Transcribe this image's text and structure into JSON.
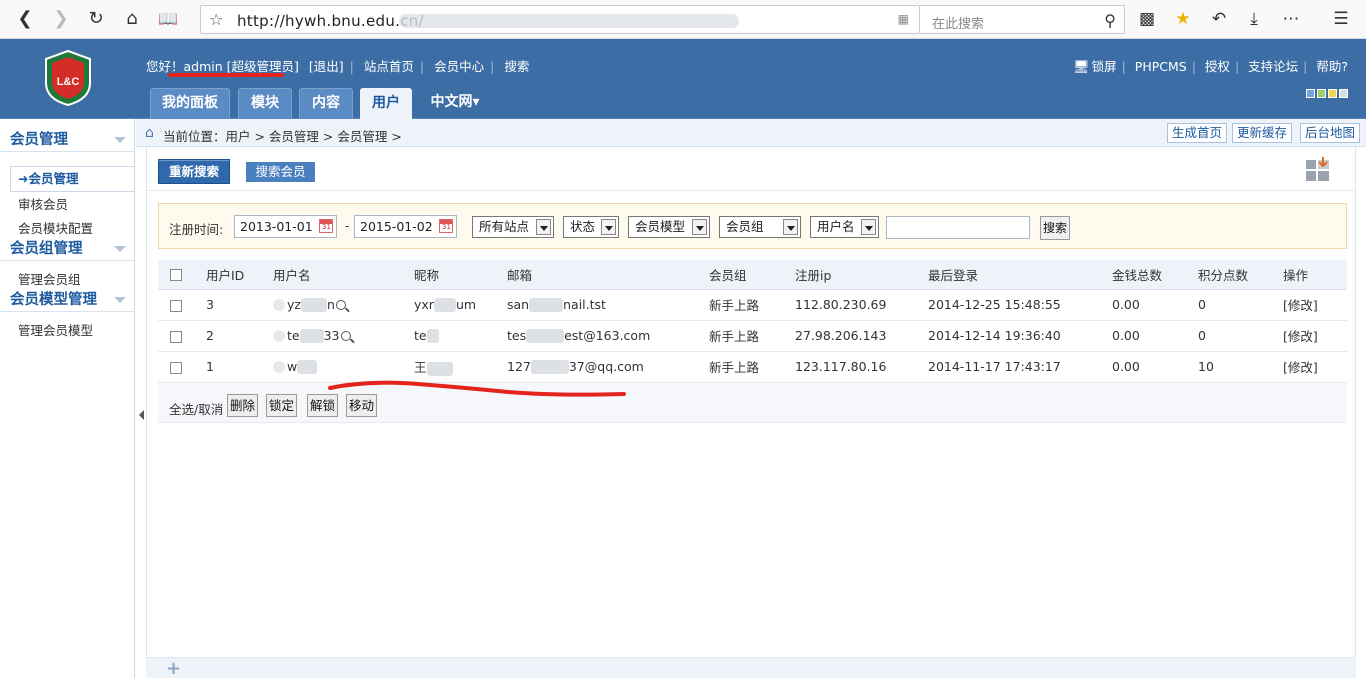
{
  "browser": {
    "url": "http://hywh.bnu.edu.cn/",
    "search_placeholder": "在此搜索",
    "icons": [
      "back-icon",
      "forward-icon",
      "reload-icon",
      "home-icon",
      "reader-icon",
      "star-outline-icon",
      "qr-icon",
      "search-icon",
      "pocket-icon",
      "bookmark-star-icon",
      "undo-icon",
      "download-icon",
      "more-icon",
      "menu-icon"
    ]
  },
  "header": {
    "greeting": "您好！",
    "user": "admin [超级管理员]",
    "logout": "[退出]",
    "links": [
      "站点首页",
      "会员中心",
      "搜索"
    ],
    "right_links": [
      "锁屏",
      "PHPCMS",
      "授权",
      "支持论坛",
      "帮助?"
    ],
    "logo_text": "L&C",
    "tabs": [
      {
        "label": "我的面板",
        "active": false
      },
      {
        "label": "模块",
        "active": false
      },
      {
        "label": "内容",
        "active": false
      },
      {
        "label": "用户",
        "active": true
      },
      {
        "label": "中文网▾",
        "active": false
      }
    ],
    "swatch_colors": [
      "#6fa6dc",
      "#9ed06a",
      "#f0d54a",
      "#d8dde4"
    ]
  },
  "sidebar": {
    "groups": [
      {
        "title": "会员管理",
        "items": [
          {
            "label": "会员管理",
            "active": true
          },
          {
            "label": "审核会员",
            "active": false
          },
          {
            "label": "会员模块配置",
            "active": false
          }
        ]
      },
      {
        "title": "会员组管理",
        "items": [
          {
            "label": "管理会员组",
            "active": false
          }
        ]
      },
      {
        "title": "会员模型管理",
        "items": [
          {
            "label": "管理会员模型",
            "active": false
          }
        ]
      }
    ]
  },
  "breadcrumb": {
    "text": "当前位置：用户 > 会员管理 > 会员管理 >",
    "buttons": [
      "生成首页",
      "更新缓存",
      "后台地图"
    ]
  },
  "toolbar": {
    "primary": "重新搜索",
    "secondary": "搜索会员"
  },
  "filter": {
    "label": "注册时间:",
    "date_from": "2013-01-01",
    "date_to": "2015-01-02",
    "dash": "-",
    "selects": [
      "所有站点",
      "状态",
      "会员模型",
      "会员组",
      "用户名"
    ],
    "keyword": "",
    "search_button": "搜索"
  },
  "table": {
    "headers": [
      "",
      "用户ID",
      "用户名",
      "昵称",
      "邮箱",
      "会员组",
      "注册ip",
      "最后登录",
      "金钱总数",
      "积分点数",
      "操作"
    ],
    "rows": [
      {
        "id": "3",
        "username_pre": "yz",
        "username_post": "n",
        "nickname_pre": "yxr",
        "nickname_post": "um",
        "email_pre": "san",
        "email_post": "nail.tst",
        "group": "新手上路",
        "ip": "112.80.230.69",
        "last_login": "2014-12-25 15:48:55",
        "money": "0.00",
        "points": "0",
        "action": "[修改]"
      },
      {
        "id": "2",
        "username_pre": "te",
        "username_post": "33",
        "nickname_pre": "te",
        "nickname_post": "",
        "email_pre": "tes",
        "email_post": "est@163.com",
        "group": "新手上路",
        "ip": "27.98.206.143",
        "last_login": "2014-12-14 19:36:40",
        "money": "0.00",
        "points": "0",
        "action": "[修改]"
      },
      {
        "id": "1",
        "username_pre": "w",
        "username_post": "",
        "nickname_pre": "王",
        "nickname_post": "",
        "email_pre": "127",
        "email_post": "37@qq.com",
        "group": "新手上路",
        "ip": "123.117.80.16",
        "last_login": "2014-11-17 17:43:17",
        "money": "0.00",
        "points": "10",
        "action": "[修改]"
      }
    ]
  },
  "footer_actions": {
    "select_all": "全选/取消",
    "buttons": [
      "删除",
      "锁定",
      "解锁",
      "移动"
    ]
  },
  "bottom": {
    "plus": "+"
  }
}
